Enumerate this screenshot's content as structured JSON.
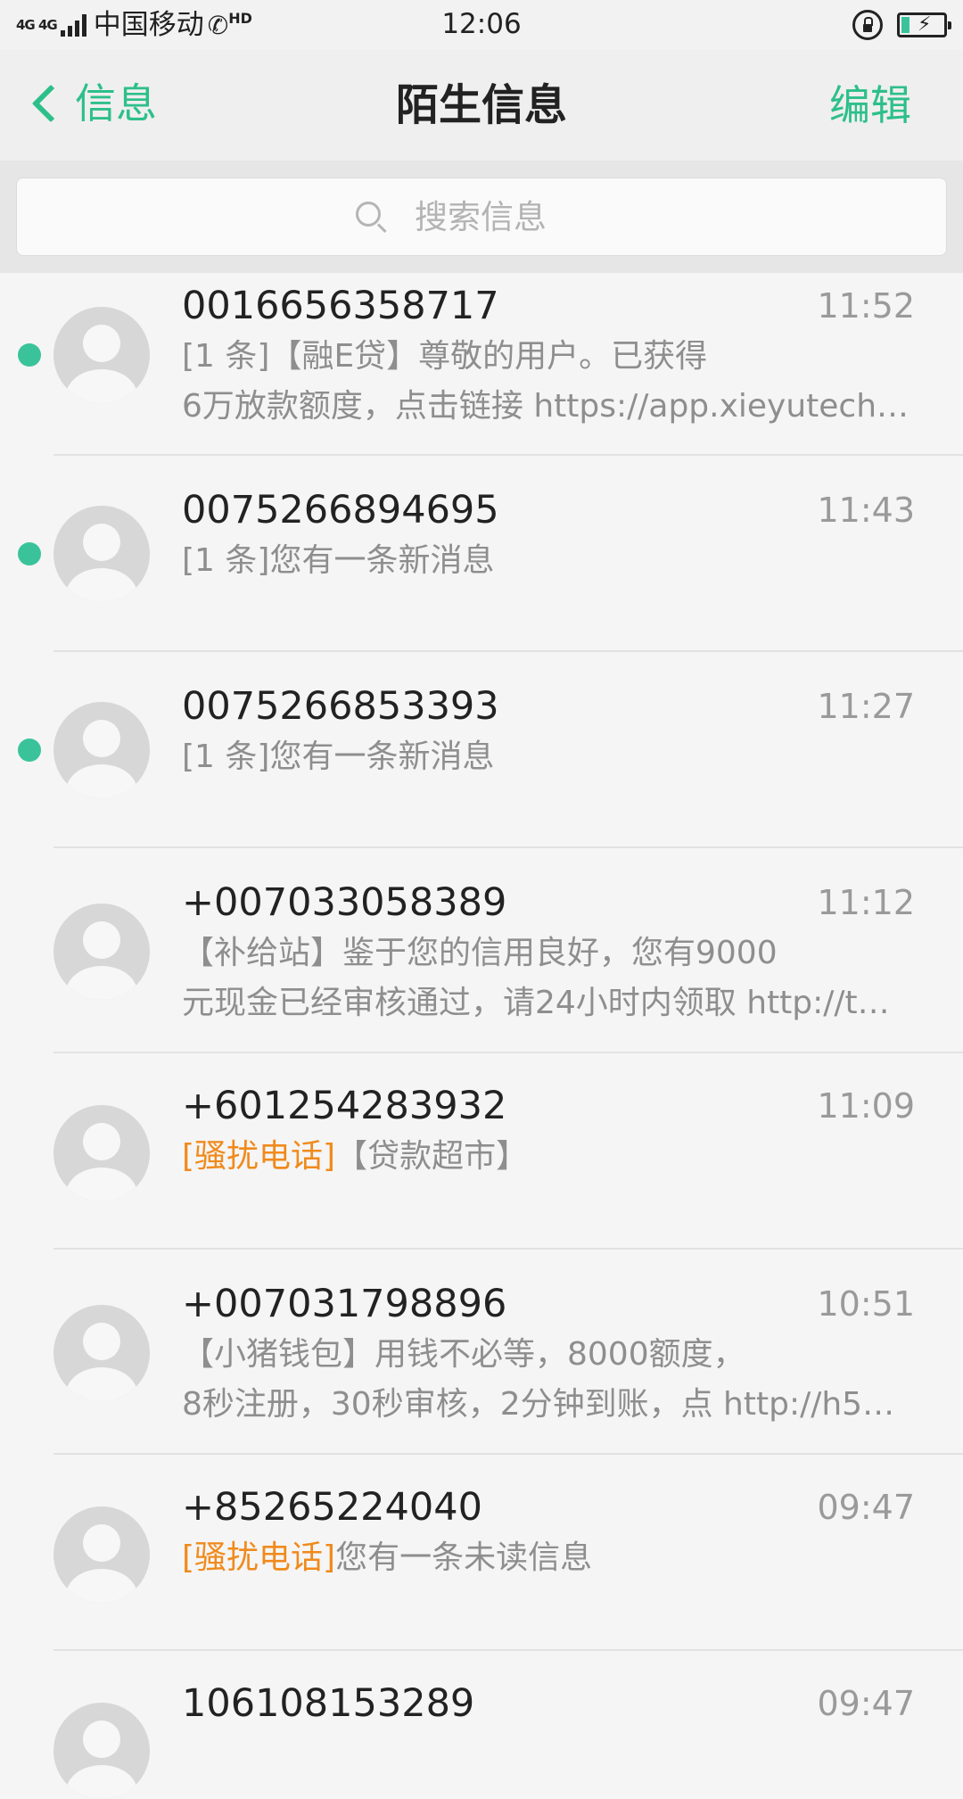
{
  "status_bar": {
    "network": "4G 4G",
    "carrier": "中国移动",
    "hd": "HD",
    "time": "12:06"
  },
  "header": {
    "back_label": "信息",
    "title": "陌生信息",
    "edit_label": "编辑"
  },
  "search": {
    "placeholder": "搜索信息"
  },
  "messages": [
    {
      "sender": "0016656358717",
      "time": "11:52",
      "unread": true,
      "tag": "",
      "preview_line1": "[1 条]【融E贷】尊敬的用户。已获得",
      "preview_line2": "6万放款额度，点击链接 https://app.xieyutech.…"
    },
    {
      "sender": "0075266894695",
      "time": "11:43",
      "unread": true,
      "tag": "",
      "preview_line1": "[1 条]您有一条新消息",
      "preview_line2": ""
    },
    {
      "sender": "0075266853393",
      "time": "11:27",
      "unread": true,
      "tag": "",
      "preview_line1": "[1 条]您有一条新消息",
      "preview_line2": ""
    },
    {
      "sender": "+007033058389",
      "time": "11:12",
      "unread": false,
      "tag": "",
      "preview_line1": "【补给站】鉴于您的信用良好，您有9000",
      "preview_line2": "元现金已经审核通过，请24小时内领取 http://t…"
    },
    {
      "sender": "+601254283932",
      "time": "11:09",
      "unread": false,
      "tag": "[骚扰电话]",
      "preview_line1": "【贷款超市】",
      "preview_line2": ""
    },
    {
      "sender": "+007031798896",
      "time": "10:51",
      "unread": false,
      "tag": "",
      "preview_line1": "【小猪钱包】用钱不必等，8000额度，",
      "preview_line2": "8秒注册，30秒审核，2分钟到账，点 http://h5…"
    },
    {
      "sender": "+85265224040",
      "time": "09:47",
      "unread": false,
      "tag": "[骚扰电话]",
      "preview_line1": "您有一条未读信息",
      "preview_line2": ""
    },
    {
      "sender": "106108153289",
      "time": "09:47",
      "unread": false,
      "tag": "",
      "preview_line1": "",
      "preview_line2": ""
    }
  ],
  "colors": {
    "accent": "#2dbf8a",
    "unread_dot": "#3ac39a",
    "spam_tag": "#f08a1c"
  }
}
